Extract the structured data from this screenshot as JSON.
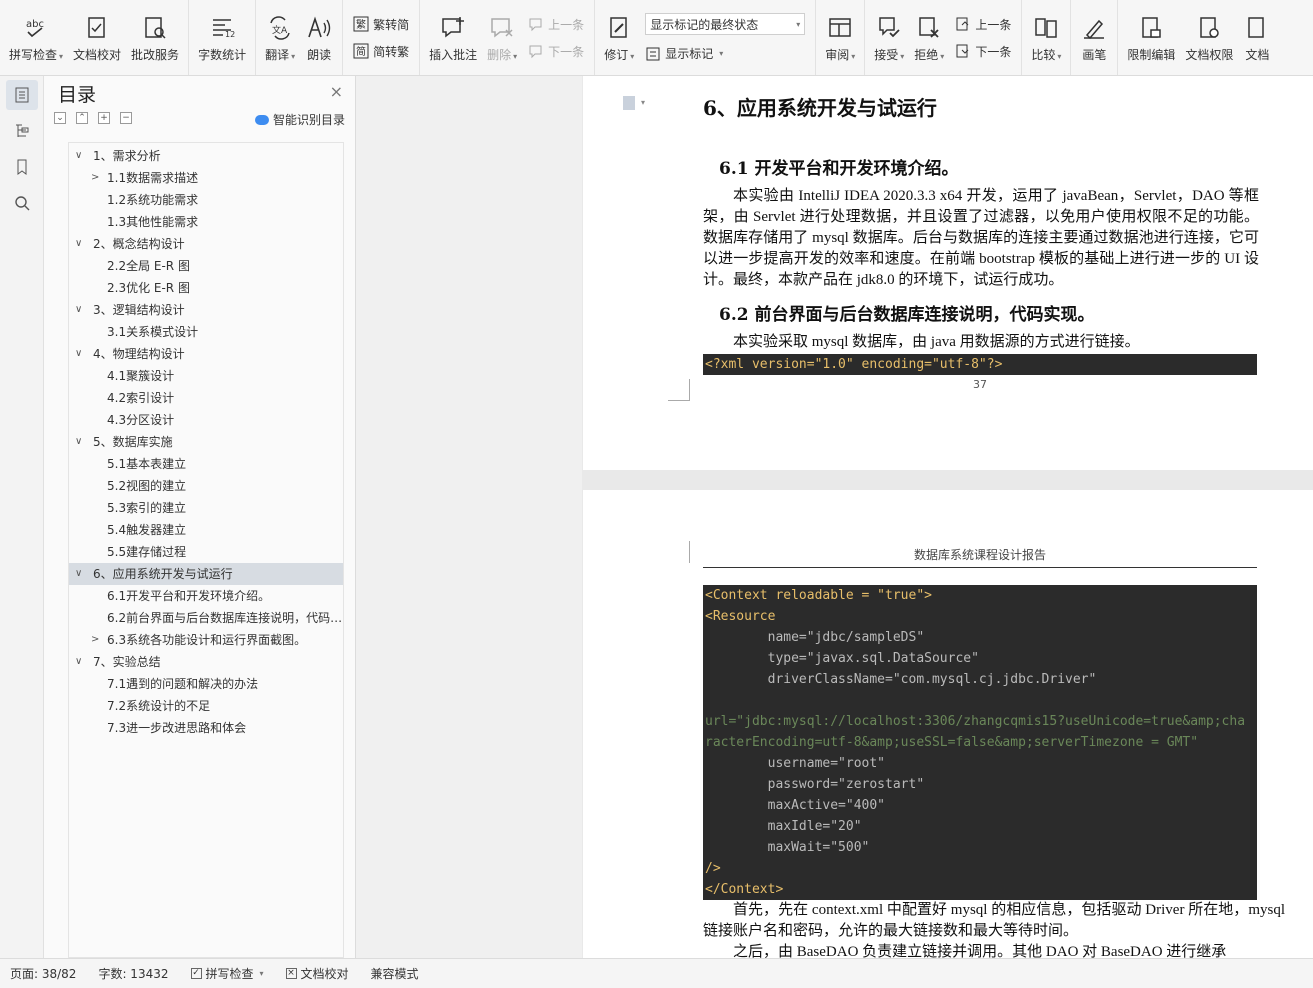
{
  "ribbon": {
    "spell_check": "拼写检查",
    "doc_proofread": "文档校对",
    "batch_service": "批改服务",
    "word_count": "字数统计",
    "translate": "翻译",
    "read_aloud": "朗读",
    "trad_to_simp": "繁转简",
    "simp_to_trad": "简转繁",
    "insert_comment": "插入批注",
    "delete": "删除",
    "prev_comment": "上一条",
    "next_comment": "下一条",
    "revise": "修订",
    "markup_select": "显示标记的最终状态",
    "show_markup": "显示标记",
    "review": "审阅",
    "accept": "接受",
    "reject": "拒绝",
    "prev_change": "上一条",
    "next_change": "下一条",
    "compare": "比较",
    "pen": "画笔",
    "restrict_edit": "限制编辑",
    "doc_permission": "文档权限",
    "doc_cut": "文档"
  },
  "toc": {
    "title": "目录",
    "close": "×",
    "smart_label": "智能识别目录",
    "items": [
      {
        "text": "1、需求分析",
        "level": 1,
        "toggle": "∨"
      },
      {
        "text": "1.1数据需求描述",
        "level": 2,
        "toggle": ">"
      },
      {
        "text": "1.2系统功能需求",
        "level": 2,
        "toggle": ""
      },
      {
        "text": "1.3其他性能需求",
        "level": 2,
        "toggle": ""
      },
      {
        "text": "2、概念结构设计",
        "level": 1,
        "toggle": "∨"
      },
      {
        "text": "2.2全局 E-R 图",
        "level": 2,
        "toggle": ""
      },
      {
        "text": "2.3优化 E-R 图",
        "level": 2,
        "toggle": ""
      },
      {
        "text": "3、逻辑结构设计",
        "level": 1,
        "toggle": "∨"
      },
      {
        "text": "3.1关系模式设计",
        "level": 2,
        "toggle": ""
      },
      {
        "text": "4、物理结构设计",
        "level": 1,
        "toggle": "∨"
      },
      {
        "text": "4.1聚簇设计",
        "level": 2,
        "toggle": ""
      },
      {
        "text": "4.2索引设计",
        "level": 2,
        "toggle": ""
      },
      {
        "text": "4.3分区设计",
        "level": 2,
        "toggle": ""
      },
      {
        "text": "5、数据库实施",
        "level": 1,
        "toggle": "∨"
      },
      {
        "text": "5.1基本表建立",
        "level": 2,
        "toggle": ""
      },
      {
        "text": "5.2视图的建立",
        "level": 2,
        "toggle": ""
      },
      {
        "text": "5.3索引的建立",
        "level": 2,
        "toggle": ""
      },
      {
        "text": "5.4触发器建立",
        "level": 2,
        "toggle": ""
      },
      {
        "text": "5.5建存储过程",
        "level": 2,
        "toggle": ""
      },
      {
        "text": "6、应用系统开发与试运行",
        "level": 1,
        "toggle": "∨",
        "selected": true
      },
      {
        "text": "6.1开发平台和开发环境介绍。",
        "level": 2,
        "toggle": ""
      },
      {
        "text": "6.2前台界面与后台数据库连接说明，代码实现。",
        "level": 2,
        "toggle": ""
      },
      {
        "text": "6.3系统各功能设计和运行界面截图。",
        "level": 2,
        "toggle": ">"
      },
      {
        "text": "7、实验总结",
        "level": 1,
        "toggle": "∨"
      },
      {
        "text": "7.1遇到的问题和解决的办法",
        "level": 2,
        "toggle": ""
      },
      {
        "text": "7.2系统设计的不足",
        "level": 2,
        "toggle": ""
      },
      {
        "text": "7.3进一步改进思路和体会",
        "level": 2,
        "toggle": ""
      }
    ]
  },
  "doc": {
    "page1": {
      "h1": "6、应用系统开发与试运行",
      "h2a": "6.1  开发平台和开发环境介绍。",
      "p1": "本实验由 IntelliJ IDEA 2020.3.3 x64 开发，运用了 javaBean，Servlet，DAO 等框架，由 Servlet 进行处理数据，并且设置了过滤器，以免用户使用权限不足的功能。数据库存储用了 mysql 数据库。后台与数据库的连接主要通过数据池进行连接，它可以进一步提高开发的效率和速度。在前端 bootstrap 模板的基础上进行进一步的 UI 设计。最终，本款产品在 jdk8.0 的环境下，试运行成功。",
      "h2b": "6.2  前台界面与后台数据库连接说明，代码实现。",
      "p2": "本实验采取 mysql 数据库，由 java 用数据源的方式进行链接。",
      "code_xml": "<?xml version=\"1.0\" encoding=\"utf-8\"?>",
      "page_number": "37"
    },
    "page2": {
      "header": "数据库系统课程设计报告",
      "code_lines": [
        "<Context reloadable = \"true\">",
        "<Resource",
        "        name=\"jdbc/sampleDS\"",
        "        type=\"javax.sql.DataSource\"",
        "        driverClassName=\"com.mysql.cj.jdbc.Driver\"",
        "",
        "url=\"jdbc:mysql://localhost:3306/zhangcqmis15?useUnicode=true&amp;cha",
        "racterEncoding=utf-8&amp;useSSL=false&amp;serverTimezone = GMT\"",
        "        username=\"root\"",
        "        password=\"zerostart\"",
        "        maxActive=\"400\"",
        "        maxIdle=\"20\"",
        "        maxWait=\"500\"",
        "/>",
        "</Context>"
      ],
      "p1": "首先，先在 context.xml 中配置好 mysql 的相应信息，包括驱动 Driver 所在地，mysql 链接账户名和密码，允许的最大链接数和最大等待时间。",
      "p2": "之后，由 BaseDAO 负责建立链接并调用。其他 DAO 对 BaseDAO 进行继承"
    }
  },
  "status": {
    "page": "页面: 38/82",
    "words": "字数: 13432",
    "spell": "拼写检查",
    "proof": "文档校对",
    "compat": "兼容模式"
  }
}
